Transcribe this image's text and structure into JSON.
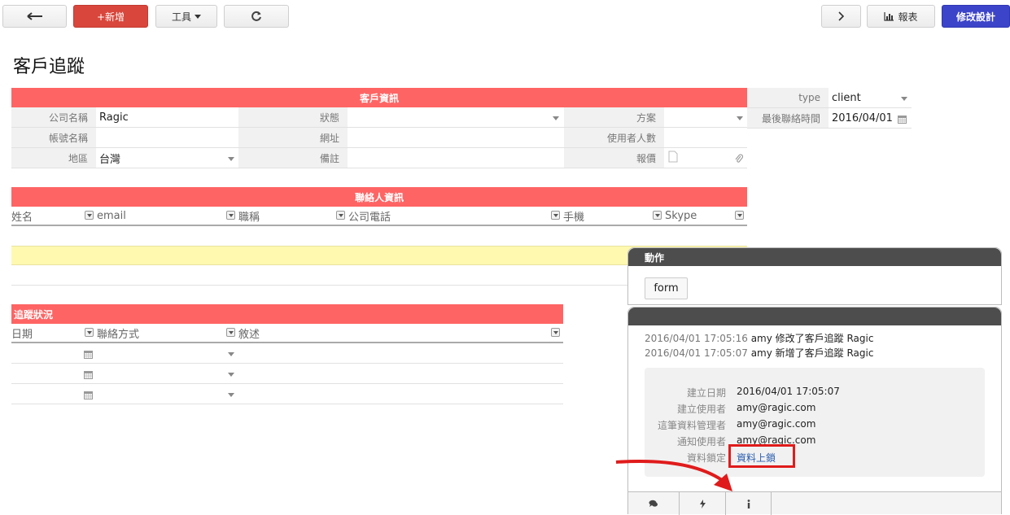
{
  "toolbar": {
    "new_label": "+新增",
    "tools_label": "工具",
    "report_label": "報表",
    "design_label": "修改設計"
  },
  "page": {
    "title": "客戶追蹤"
  },
  "customer_info": {
    "header": "客戶資訊",
    "fields": {
      "company_name": {
        "label": "公司名稱",
        "value": "Ragic"
      },
      "status": {
        "label": "狀態",
        "value": ""
      },
      "plan": {
        "label": "方案",
        "value": ""
      },
      "account_name": {
        "label": "帳號名稱",
        "value": ""
      },
      "website": {
        "label": "網址",
        "value": ""
      },
      "user_count": {
        "label": "使用者人數",
        "value": ""
      },
      "region": {
        "label": "地區",
        "value": "台灣"
      },
      "remarks": {
        "label": "備註",
        "value": ""
      },
      "quote": {
        "label": "報價",
        "value": ""
      },
      "type": {
        "label": "type",
        "value": "client"
      },
      "last_contact": {
        "label": "最後聯絡時間",
        "value": "2016/04/01"
      }
    }
  },
  "contacts": {
    "header": "聯絡人資訊",
    "columns": [
      "姓名",
      "email",
      "職稱",
      "公司電話",
      "手機",
      "Skype"
    ]
  },
  "tracking": {
    "header": "追蹤狀況",
    "columns": [
      "日期",
      "聯絡方式",
      "敘述"
    ]
  },
  "actions_panel": {
    "header": "動作",
    "form_button": "form"
  },
  "history_panel": {
    "logs": [
      {
        "ts": "2016/04/01 17:05:16",
        "text": "amy 修改了客戶追蹤 Ragic"
      },
      {
        "ts": "2016/04/01 17:05:07",
        "text": "amy 新增了客戶追蹤 Ragic"
      }
    ],
    "info": [
      {
        "label": "建立日期",
        "value": "2016/04/01 17:05:07"
      },
      {
        "label": "建立使用者",
        "value": "amy@ragic.com"
      },
      {
        "label": "這筆資料管理者",
        "value": "amy@ragic.com"
      },
      {
        "label": "通知使用者",
        "value": "amy@ragic.com"
      },
      {
        "label": "資料鎖定",
        "value": "資料上鎖"
      }
    ]
  },
  "colors": {
    "section_header": "#ff6464",
    "highlight_row": "#fff9b0",
    "new_button": "#d9463b",
    "design_button": "#3c44c9",
    "annotation": "#e01b1b"
  }
}
